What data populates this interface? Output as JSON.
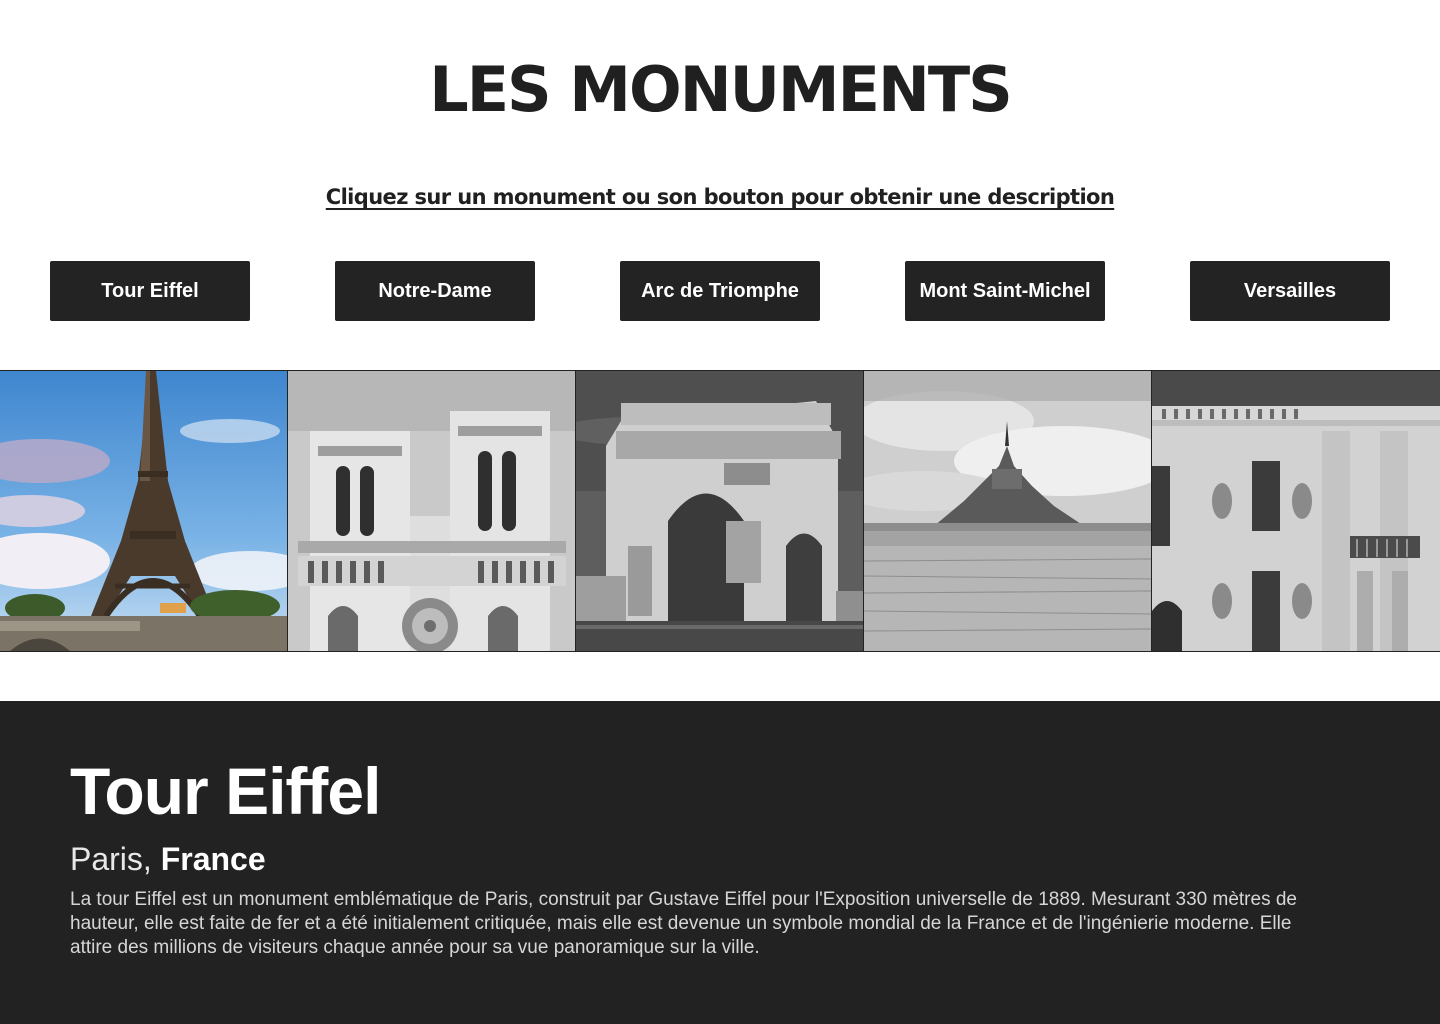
{
  "page": {
    "title": "LES MONUMENTS",
    "instruction": "Cliquez sur un monument ou son bouton pour obtenir une description"
  },
  "buttons": [
    {
      "label": "Tour Eiffel"
    },
    {
      "label": "Notre-Dame"
    },
    {
      "label": "Arc de Triomphe"
    },
    {
      "label": "Mont Saint-Michel"
    },
    {
      "label": "Versailles"
    }
  ],
  "gallery": [
    {
      "name": "eiffel-tower-photo",
      "style": "color"
    },
    {
      "name": "notre-dame-photo",
      "style": "grayscale"
    },
    {
      "name": "arc-de-triomphe-photo",
      "style": "grayscale"
    },
    {
      "name": "mont-saint-michel-photo",
      "style": "grayscale"
    },
    {
      "name": "versailles-photo",
      "style": "grayscale"
    }
  ],
  "description": {
    "name": "Tour Eiffel",
    "city": "Paris,",
    "country": "France",
    "text": "La tour Eiffel est un monument emblématique de Paris, construit par Gustave Eiffel pour l'Exposition universelle de 1889. Mesurant 330 mètres de hauteur, elle est faite de fer et a été initialement critiquée, mais elle est devenue un symbole mondial de la France et de l'ingénierie moderne. Elle attire des millions de visiteurs chaque année pour sa vue panoramique sur la ville."
  },
  "colors": {
    "primary_dark": "#222222",
    "button": "#232323",
    "text": "#202020",
    "on_dark": "#ffffff"
  }
}
